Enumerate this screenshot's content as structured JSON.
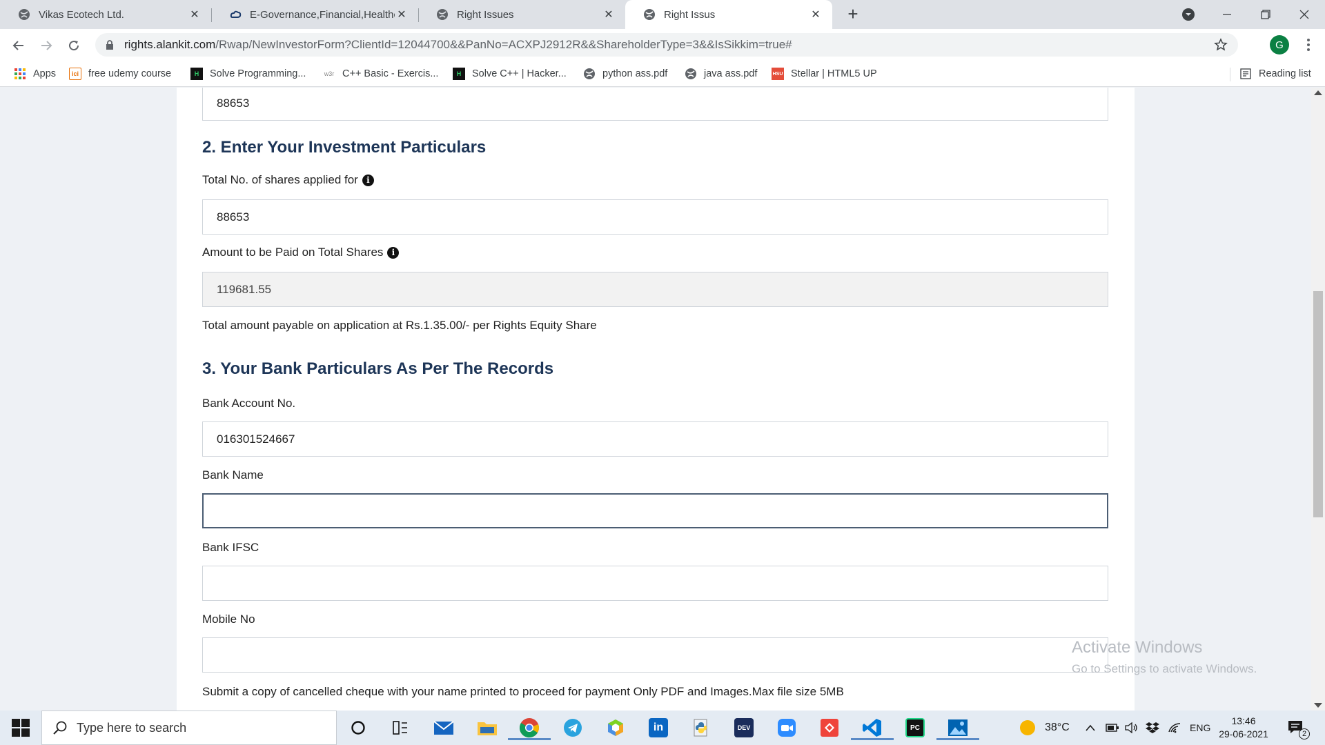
{
  "browser": {
    "tabs": [
      {
        "title": "Vikas Ecotech Ltd.",
        "icon": "globe-icon",
        "active": false
      },
      {
        "title": "E-Governance,Financial,Healthcar",
        "icon": "cloud-icon",
        "active": false
      },
      {
        "title": "Right Issues",
        "icon": "globe-icon",
        "active": false
      },
      {
        "title": "Right Issus",
        "icon": "globe-icon",
        "active": true
      }
    ],
    "new_tab_label": "+",
    "url_host": "rights.alankit.com",
    "url_path": "/Rwap/NewInvestorForm?ClientId=12044700&&PanNo=ACXPJ2912R&&ShareholderType=3&&IsSikkim=true#",
    "profile_initial": "G"
  },
  "bookmarks": {
    "items": [
      {
        "label": "Apps",
        "icon": "apps-grid-icon"
      },
      {
        "label": "free udemy course",
        "icon": "site-icon"
      },
      {
        "label": "Solve Programming...",
        "icon": "hackerrank-icon"
      },
      {
        "label": "C++ Basic - Exercis...",
        "icon": "w3resource-icon"
      },
      {
        "label": "Solve C++ | Hacker...",
        "icon": "hackerrank-icon"
      },
      {
        "label": "python ass.pdf",
        "icon": "globe-icon"
      },
      {
        "label": "java ass.pdf",
        "icon": "globe-icon"
      },
      {
        "label": "Stellar | HTML5 UP",
        "icon": "html5up-icon"
      }
    ],
    "reading_list": "Reading list"
  },
  "form": {
    "prev_value": "88653",
    "section2_heading": "2. Enter Your Investment Particulars",
    "shares_label": "Total No. of shares applied for",
    "shares_value": "88653",
    "amount_label": "Amount to be Paid on Total Shares",
    "amount_value": "119681.55",
    "amount_note": "Total amount payable on application at Rs.1.35.00/- per Rights Equity Share",
    "section3_heading": "3. Your Bank Particulars As Per The Records",
    "account_label": "Bank Account No.",
    "account_value": "016301524667",
    "bank_name_label": "Bank Name",
    "bank_name_value": "",
    "ifsc_label": "Bank IFSC",
    "ifsc_value": "",
    "mobile_label": "Mobile No",
    "mobile_value": "",
    "cheque_note": "Submit a copy of cancelled cheque with your name printed to proceed for payment Only PDF and Images.Max file size 5MB",
    "info_glyph": "i"
  },
  "watermark": {
    "line1": "Activate Windows",
    "line2": "Go to Settings to activate Windows."
  },
  "taskbar": {
    "search_placeholder": "Type here to search",
    "weather": "38°C",
    "language": "ENG",
    "time": "13:46",
    "date": "29-06-2021",
    "notification_count": "2",
    "apps": [
      "cortana-icon",
      "task-view-icon",
      "mail-icon",
      "file-explorer-icon",
      "chrome-icon",
      "telegram-icon",
      "app-icon",
      "linkedin-icon",
      "python-icon",
      "devcpp-icon",
      "zoom-icon",
      "anydesk-icon",
      "vscode-icon",
      "pycharm-icon",
      "photos-icon"
    ]
  },
  "colors": {
    "heading": "#1d3557",
    "focus_border": "#4b5d73",
    "tab_strip": "#dee1e6"
  }
}
